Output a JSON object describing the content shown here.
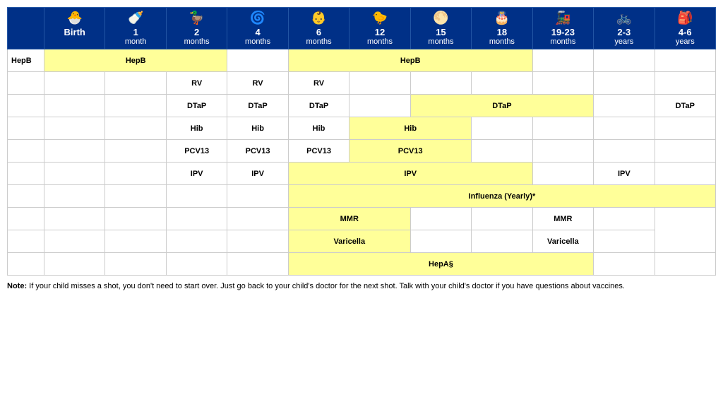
{
  "headers": [
    {
      "icon": "🐣",
      "age": "Birth",
      "sub": ""
    },
    {
      "icon": "🍼",
      "age": "1",
      "sub": "month"
    },
    {
      "icon": "🦆",
      "age": "2",
      "sub": "months"
    },
    {
      "icon": "🌀",
      "age": "4",
      "sub": "months"
    },
    {
      "icon": "👶",
      "age": "6",
      "sub": "months"
    },
    {
      "icon": "🐣",
      "age": "12",
      "sub": "months"
    },
    {
      "icon": "🌕",
      "age": "15",
      "sub": "months"
    },
    {
      "icon": "🎂",
      "age": "18",
      "sub": "months"
    },
    {
      "icon": "🚂",
      "age": "19-23",
      "sub": "months"
    },
    {
      "icon": "🚲",
      "age": "2-3",
      "sub": "years"
    },
    {
      "icon": "🎒",
      "age": "4-6",
      "sub": "years"
    }
  ],
  "rows": [
    {
      "label": "HepB",
      "cells": [
        {
          "type": "yellow",
          "text": "HepB",
          "colspan": 3
        },
        {
          "type": "empty",
          "text": ""
        },
        {
          "type": "yellow",
          "text": "HepB",
          "colspan": 4
        },
        {
          "type": "empty",
          "text": ""
        },
        {
          "type": "empty",
          "text": ""
        },
        {
          "type": "empty",
          "text": ""
        }
      ]
    },
    {
      "label": "",
      "cells": [
        {
          "type": "empty"
        },
        {
          "type": "empty"
        },
        {
          "type": "plain",
          "text": "RV"
        },
        {
          "type": "plain",
          "text": "RV"
        },
        {
          "type": "plain",
          "text": "RV"
        },
        {
          "type": "empty"
        },
        {
          "type": "empty"
        },
        {
          "type": "empty"
        },
        {
          "type": "empty"
        },
        {
          "type": "empty"
        },
        {
          "type": "empty"
        }
      ]
    },
    {
      "label": "",
      "cells": [
        {
          "type": "empty"
        },
        {
          "type": "empty"
        },
        {
          "type": "plain",
          "text": "DTaP"
        },
        {
          "type": "plain",
          "text": "DTaP"
        },
        {
          "type": "plain",
          "text": "DTaP"
        },
        {
          "type": "empty"
        },
        {
          "type": "yellow",
          "text": "DTaP",
          "colspan": 3
        },
        {
          "type": "empty"
        },
        {
          "type": "plain",
          "text": "DTaP"
        },
        {
          "type": "empty"
        }
      ]
    },
    {
      "label": "",
      "cells": [
        {
          "type": "empty"
        },
        {
          "type": "empty"
        },
        {
          "type": "plain",
          "text": "Hib"
        },
        {
          "type": "plain",
          "text": "Hib"
        },
        {
          "type": "plain",
          "text": "Hib"
        },
        {
          "type": "yellow",
          "text": "Hib",
          "colspan": 2
        },
        {
          "type": "empty"
        },
        {
          "type": "empty"
        },
        {
          "type": "empty"
        },
        {
          "type": "empty"
        }
      ]
    },
    {
      "label": "",
      "cells": [
        {
          "type": "empty"
        },
        {
          "type": "empty"
        },
        {
          "type": "plain",
          "text": "PCV13"
        },
        {
          "type": "plain",
          "text": "PCV13"
        },
        {
          "type": "plain",
          "text": "PCV13"
        },
        {
          "type": "yellow",
          "text": "PCV13",
          "colspan": 2
        },
        {
          "type": "empty"
        },
        {
          "type": "empty"
        },
        {
          "type": "empty"
        },
        {
          "type": "empty"
        }
      ]
    },
    {
      "label": "",
      "cells": [
        {
          "type": "empty"
        },
        {
          "type": "empty"
        },
        {
          "type": "plain",
          "text": "IPV"
        },
        {
          "type": "plain",
          "text": "IPV"
        },
        {
          "type": "yellow",
          "text": "IPV",
          "colspan": 4
        },
        {
          "type": "empty"
        },
        {
          "type": "plain",
          "text": "IPV"
        }
      ]
    },
    {
      "label": "",
      "cells": [
        {
          "type": "empty"
        },
        {
          "type": "empty"
        },
        {
          "type": "empty"
        },
        {
          "type": "empty"
        },
        {
          "type": "yellow",
          "text": "Influenza (Yearly)*",
          "colspan": 7
        }
      ]
    },
    {
      "label": "",
      "cells": [
        {
          "type": "empty"
        },
        {
          "type": "empty"
        },
        {
          "type": "empty"
        },
        {
          "type": "empty"
        },
        {
          "type": "yellow",
          "text": "MMR",
          "colspan": 2
        },
        {
          "type": "empty"
        },
        {
          "type": "empty"
        },
        {
          "type": "plain",
          "text": "MMR"
        },
        {
          "type": "empty"
        }
      ]
    },
    {
      "label": "",
      "cells": [
        {
          "type": "empty"
        },
        {
          "type": "empty"
        },
        {
          "type": "empty"
        },
        {
          "type": "empty"
        },
        {
          "type": "yellow",
          "text": "Varicella",
          "colspan": 2
        },
        {
          "type": "empty"
        },
        {
          "type": "empty"
        },
        {
          "type": "plain",
          "text": "Varicella"
        },
        {
          "type": "empty"
        }
      ]
    },
    {
      "label": "",
      "cells": [
        {
          "type": "empty"
        },
        {
          "type": "empty"
        },
        {
          "type": "empty"
        },
        {
          "type": "empty"
        },
        {
          "type": "yellow",
          "text": "HepA§",
          "colspan": 5
        },
        {
          "type": "empty"
        },
        {
          "type": "empty"
        }
      ]
    }
  ],
  "note": "Note: If your child misses a shot, you don't need to start over. Just go back to your child's doctor for the next shot. Talk with your child's doctor if you have questions about vaccines."
}
